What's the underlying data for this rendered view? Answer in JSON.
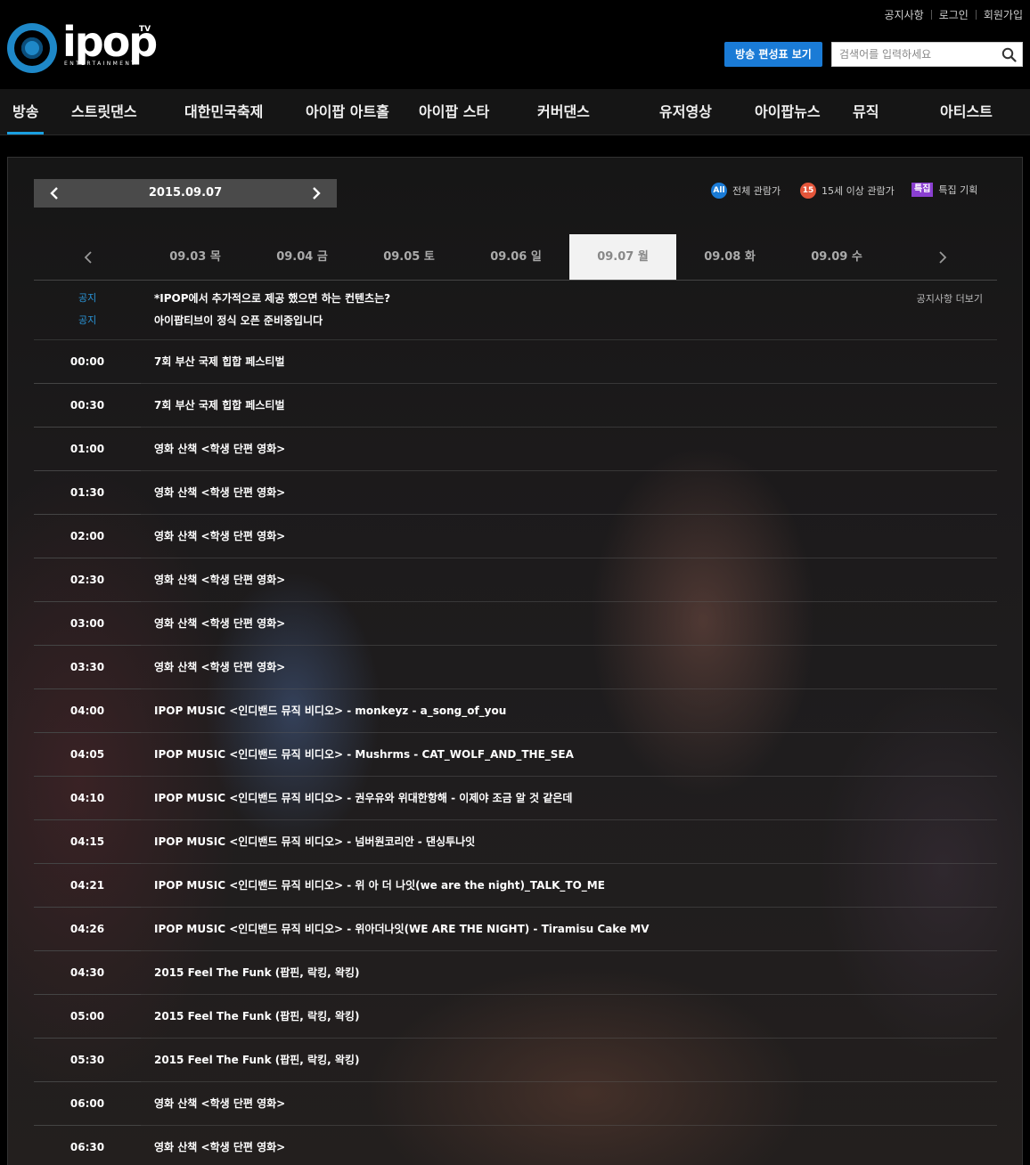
{
  "header": {
    "logo_text": "ipop",
    "logo_tv": "TV",
    "logo_sub": "ENTERTAINMENT",
    "top_links": [
      "공지사항",
      "로그인",
      "회원가입"
    ],
    "schedule_button": "방송 편성표 보기",
    "search_placeholder": "검색어를 입력하세요"
  },
  "nav": {
    "items": [
      "방송",
      "스트릿댄스",
      "대한민국축제",
      "아이팝 아트홀",
      "아이팝 스타",
      "커버댄스",
      "유저영상",
      "아이팝뉴스",
      "뮤직",
      "아티스트"
    ],
    "active_index": 0
  },
  "date_bar": {
    "current_date": "2015.09.07"
  },
  "legend": {
    "all_badge": "All",
    "all_label": "전체 관람가",
    "age15_badge": "15",
    "age15_label": "15세 이상 관람가",
    "special_badge": "특집",
    "special_label": "특집 기획"
  },
  "days": {
    "tabs": [
      "09.03 목",
      "09.04 금",
      "09.05 토",
      "09.06 일",
      "09.07 월",
      "09.08 화",
      "09.09 수"
    ],
    "active_index": 4
  },
  "notices": {
    "items": [
      {
        "tag": "공지",
        "text": "*IPOP에서 추가적으로 제공 했으면 하는 컨텐츠는?"
      },
      {
        "tag": "공지",
        "text": "아이팝티브이 정식 오픈 준비중입니다"
      }
    ],
    "more_label": "공지사항 더보기"
  },
  "schedule": [
    {
      "time": "00:00",
      "title": "7회 부산 국제 힙합 페스티벌"
    },
    {
      "time": "00:30",
      "title": "7회 부산 국제 힙합 페스티벌"
    },
    {
      "time": "01:00",
      "title": "영화 산책 <학생 단편 영화>"
    },
    {
      "time": "01:30",
      "title": "영화 산책 <학생 단편 영화>"
    },
    {
      "time": "02:00",
      "title": "영화 산책 <학생 단편 영화>"
    },
    {
      "time": "02:30",
      "title": "영화 산책 <학생 단편 영화>"
    },
    {
      "time": "03:00",
      "title": "영화 산책 <학생 단편 영화>"
    },
    {
      "time": "03:30",
      "title": "영화 산책 <학생 단편 영화>"
    },
    {
      "time": "04:00",
      "title": "IPOP MUSIC <인디밴드 뮤직 비디오> - monkeyz - a_song_of_you"
    },
    {
      "time": "04:05",
      "title": "IPOP MUSIC <인디밴드 뮤직 비디오> - Mushrms - CAT_WOLF_AND_THE_SEA"
    },
    {
      "time": "04:10",
      "title": "IPOP MUSIC <인디밴드 뮤직 비디오> - 권우유와 위대한항해 - 이제야 조금 알 것 같은데"
    },
    {
      "time": "04:15",
      "title": "IPOP MUSIC <인디밴드 뮤직 비디오> - 넘버원코리안 - 댄싱투나잇"
    },
    {
      "time": "04:21",
      "title": "IPOP MUSIC <인디밴드 뮤직 비디오> - 위 아 더 나잇(we are the night)_TALK_TO_ME"
    },
    {
      "time": "04:26",
      "title": "IPOP MUSIC <인디밴드 뮤직 비디오> - 위아더나잇(WE ARE THE NIGHT) - Tiramisu Cake MV"
    },
    {
      "time": "04:30",
      "title": "2015 Feel The Funk (팝핀, 락킹, 왁킹)"
    },
    {
      "time": "05:00",
      "title": "2015 Feel The Funk (팝핀, 락킹, 왁킹)"
    },
    {
      "time": "05:30",
      "title": "2015 Feel The Funk (팝핀, 락킹, 왁킹)"
    },
    {
      "time": "06:00",
      "title": "영화 산책 <학생 단편 영화>"
    },
    {
      "time": "06:30",
      "title": "영화 산책 <학생 단편 영화>"
    }
  ],
  "colors": {
    "accent": "#1a7bd6",
    "nav_underline": "#1a9fe0",
    "notice_tag": "#2a95d8",
    "age15": "#e4553a",
    "special": "#8a3fd1"
  }
}
